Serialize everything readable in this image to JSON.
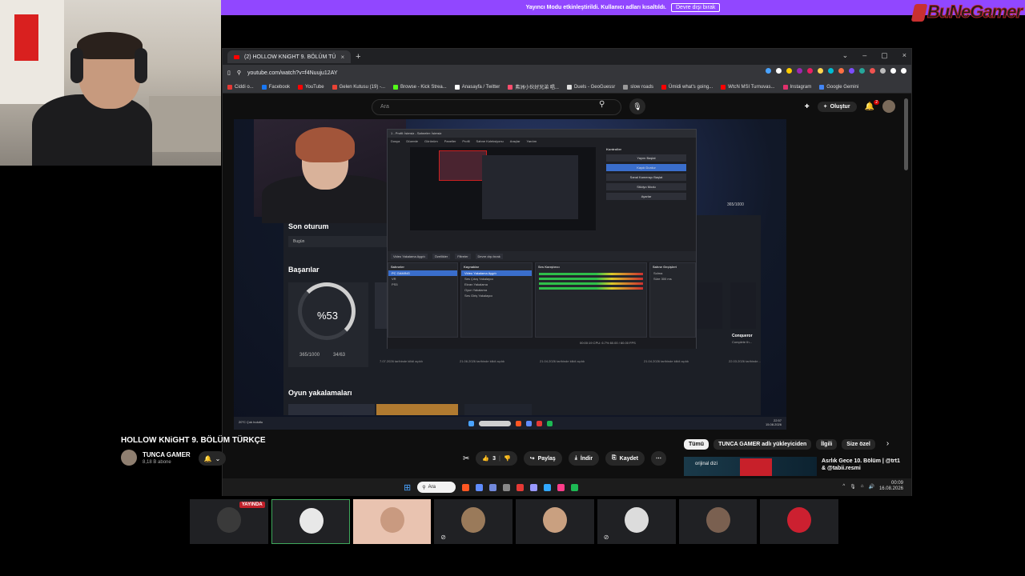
{
  "notice": {
    "message": "Yayıncı Modu etkinleştirildi. Kullanıcı adları kısaltıldı.",
    "button": "Devre dışı bırak"
  },
  "logo": {
    "text": "BuNeGamer"
  },
  "browser": {
    "tab_title": "(2) HOLLOW KNiGHT 9. BÖLÜM TÜ",
    "tab_close": "×",
    "new_tab": "+",
    "window_controls": [
      "⌄",
      "–",
      "▢",
      "×"
    ],
    "url": "youtube.com/watch?v=f4Nuuju12AY",
    "bookmarks": [
      {
        "label": "Ciddi o...",
        "color": "#e53935"
      },
      {
        "label": "Facebook",
        "color": "#1877f2"
      },
      {
        "label": "YouTube",
        "color": "#ff0000"
      },
      {
        "label": "Gelen Kutusu (19) -...",
        "color": "#ea4335"
      },
      {
        "label": "Browse - Kick Strea...",
        "color": "#53fc18"
      },
      {
        "label": "Anasayfa / Twitter",
        "color": "#ffffff"
      },
      {
        "label": "弗洲小伙好兄弟 唱...",
        "color": "#ff4d6d"
      },
      {
        "label": "Duels - GeoGuessr",
        "color": "#e0e0e0"
      },
      {
        "label": "slow roads",
        "color": "#999999"
      },
      {
        "label": "Ümidi what's going...",
        "color": "#ff0000"
      },
      {
        "label": "WtcN MSI Turnuvas...",
        "color": "#ff0000"
      },
      {
        "label": "Instagram",
        "color": "#e1306c"
      },
      {
        "label": "Google Gemini",
        "color": "#4285f4"
      }
    ],
    "extension_colors": [
      "#4aa3ff",
      "#ffffff",
      "#ffcc00",
      "#9c27b0",
      "#e91e63",
      "#ffd54f",
      "#00bcd4",
      "#ff7043",
      "#7c4dff",
      "#26a69a",
      "#ef5350",
      "#bdbdbd",
      "#ffffff",
      "#ffffff"
    ]
  },
  "youtube": {
    "search_placeholder": "Ara",
    "create_label": "Oluştur",
    "notif_count": "2",
    "video_title": "HOLLOW KNiGHT 9. BÖLÜM TÜRKÇE",
    "channel_name": "TUNCA GAMER",
    "channel_subs": "8,18 B abone",
    "likes": "3",
    "share_label": "Paylaş",
    "download_label": "İndir",
    "save_label": "Kaydet",
    "more": "⋯",
    "chips": [
      "Tümü",
      "TUNCA GAMER adlı yükleyiciden",
      "İlgili",
      "Size özel"
    ],
    "chip_next": "›",
    "rec_title": "Asrlık Gece 10. Bölüm | @trt1 & @tabii.resmi",
    "rec_overlay": "orijinal dizi"
  },
  "video": {
    "section_session": "Son oturum",
    "session_sub": "Bugün",
    "section_achievements": "Başarılar",
    "achievement_percent": "%53",
    "points": "365/1000",
    "trophies": "34/63",
    "top_points": "365/1000",
    "section_captures": "Oyun yakalamaları",
    "card_name": "Conqueror",
    "card_sub": "Complete th...",
    "card_dates": [
      "7.07.2026 tarihinde kilidi açıldı",
      "21.06.2026 tarihinde kilidi açıldı",
      "21.04.2026 tarihinde kilidi açıldı",
      "21.04.2026 tarihinde kilidi açıldı",
      "22.03.2026 tarihinde..."
    ]
  },
  "obs": {
    "title": "1 - Profil: İsimsiz - Sahneler: İsimsiz",
    "menu": [
      "Dosya",
      "Düzenle",
      "Görünüm",
      "Paneller",
      "Profil",
      "Sahne Koleksiyonu",
      "Araçlar",
      "Yardım"
    ],
    "controls_header": "Kontroller",
    "controls": [
      "Yayını Başlat",
      "Kaydı Durdur",
      "Sanal Kamerayı Başlat",
      "Stüdyo Modu",
      "Ayarlar"
    ],
    "source_bar": [
      "Video Yakalama Aygıtı",
      "Özellikler",
      "Filtreler",
      "Devre dışı bırak"
    ],
    "scenes_header": "Sahneler",
    "scenes": [
      "PC GAMING",
      "VR",
      "PS5"
    ],
    "sources_header": "Kaynaklar",
    "sources": [
      "Video Yakalama Aygıtı",
      "Ses Çıkış Yakalayıcı",
      "Ekran Yakalama",
      "Oyun Yakalama",
      "Ses Giriş Yakalayıcı"
    ],
    "mixer_header": "Ses Karıştırıcı",
    "transitions_header": "Sahne Geçişleri",
    "transition_type": "Solma",
    "duration_label": "Süre",
    "duration_value": "300 ms",
    "status": "00:00:19   CPU: 6.7%   60.00 / 60.00 FPS"
  },
  "inner_taskbar": {
    "time": "22:57",
    "date": "15.08.2026",
    "weather": "20°C Çok bulutlu"
  },
  "windows_taskbar": {
    "search_label": "Ara",
    "start_icon": "⊞",
    "tray_lang": "^",
    "time": "00:09",
    "date": "16.08.2026",
    "app_colors": [
      "#ff5722",
      "#5f8cff",
      "#7289da",
      "#888888",
      "#e53935",
      "#9999ff",
      "#31a8ff",
      "#ff3d8a",
      "#1db954"
    ]
  },
  "tiles": {
    "live_badge": "YAYINDA",
    "face_colors": [
      "#3a3a3a",
      "#e8e8e8",
      "#c99a80",
      "#9a7a5a",
      "#c9a080",
      "#dcdcdc",
      "#7a6050",
      "#cc2030"
    ]
  }
}
